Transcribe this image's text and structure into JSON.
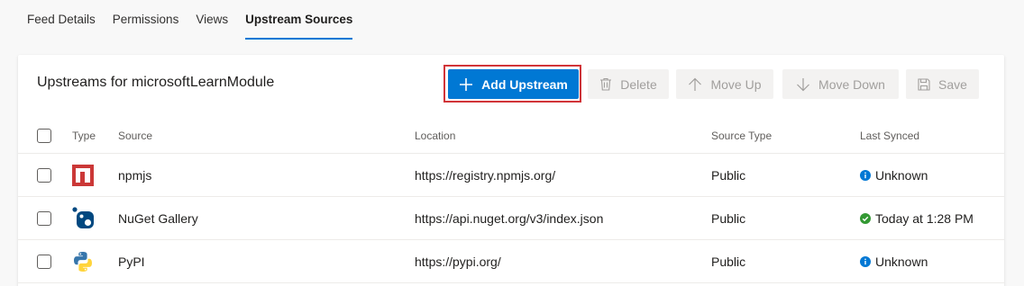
{
  "tabs": [
    {
      "label": "Feed Details",
      "active": false
    },
    {
      "label": "Permissions",
      "active": false
    },
    {
      "label": "Views",
      "active": false
    },
    {
      "label": "Upstream Sources",
      "active": true
    }
  ],
  "card": {
    "title": "Upstreams for microsoftLearnModule"
  },
  "toolbar": {
    "add_label": "Add Upstream",
    "delete_label": "Delete",
    "move_up_label": "Move Up",
    "move_down_label": "Move Down",
    "save_label": "Save"
  },
  "table": {
    "headers": {
      "type": "Type",
      "source": "Source",
      "location": "Location",
      "source_type": "Source Type",
      "last_synced": "Last Synced"
    },
    "rows": [
      {
        "icon": "npm-icon",
        "source": "npmjs",
        "location": "https://registry.npmjs.org/",
        "source_type": "Public",
        "status_icon": "info-icon",
        "last_synced": "Unknown"
      },
      {
        "icon": "nuget-icon",
        "source": "NuGet Gallery",
        "location": "https://api.nuget.org/v3/index.json",
        "source_type": "Public",
        "status_icon": "success-check-icon",
        "last_synced": "Today at 1:28 PM"
      },
      {
        "icon": "python-icon",
        "source": "PyPI",
        "location": "https://pypi.org/",
        "source_type": "Public",
        "status_icon": "info-icon",
        "last_synced": "Unknown"
      }
    ]
  },
  "colors": {
    "accent": "#0078d4",
    "highlight": "#d13438",
    "success": "#339933",
    "npm": "#cb3837",
    "nuget": "#004880"
  }
}
